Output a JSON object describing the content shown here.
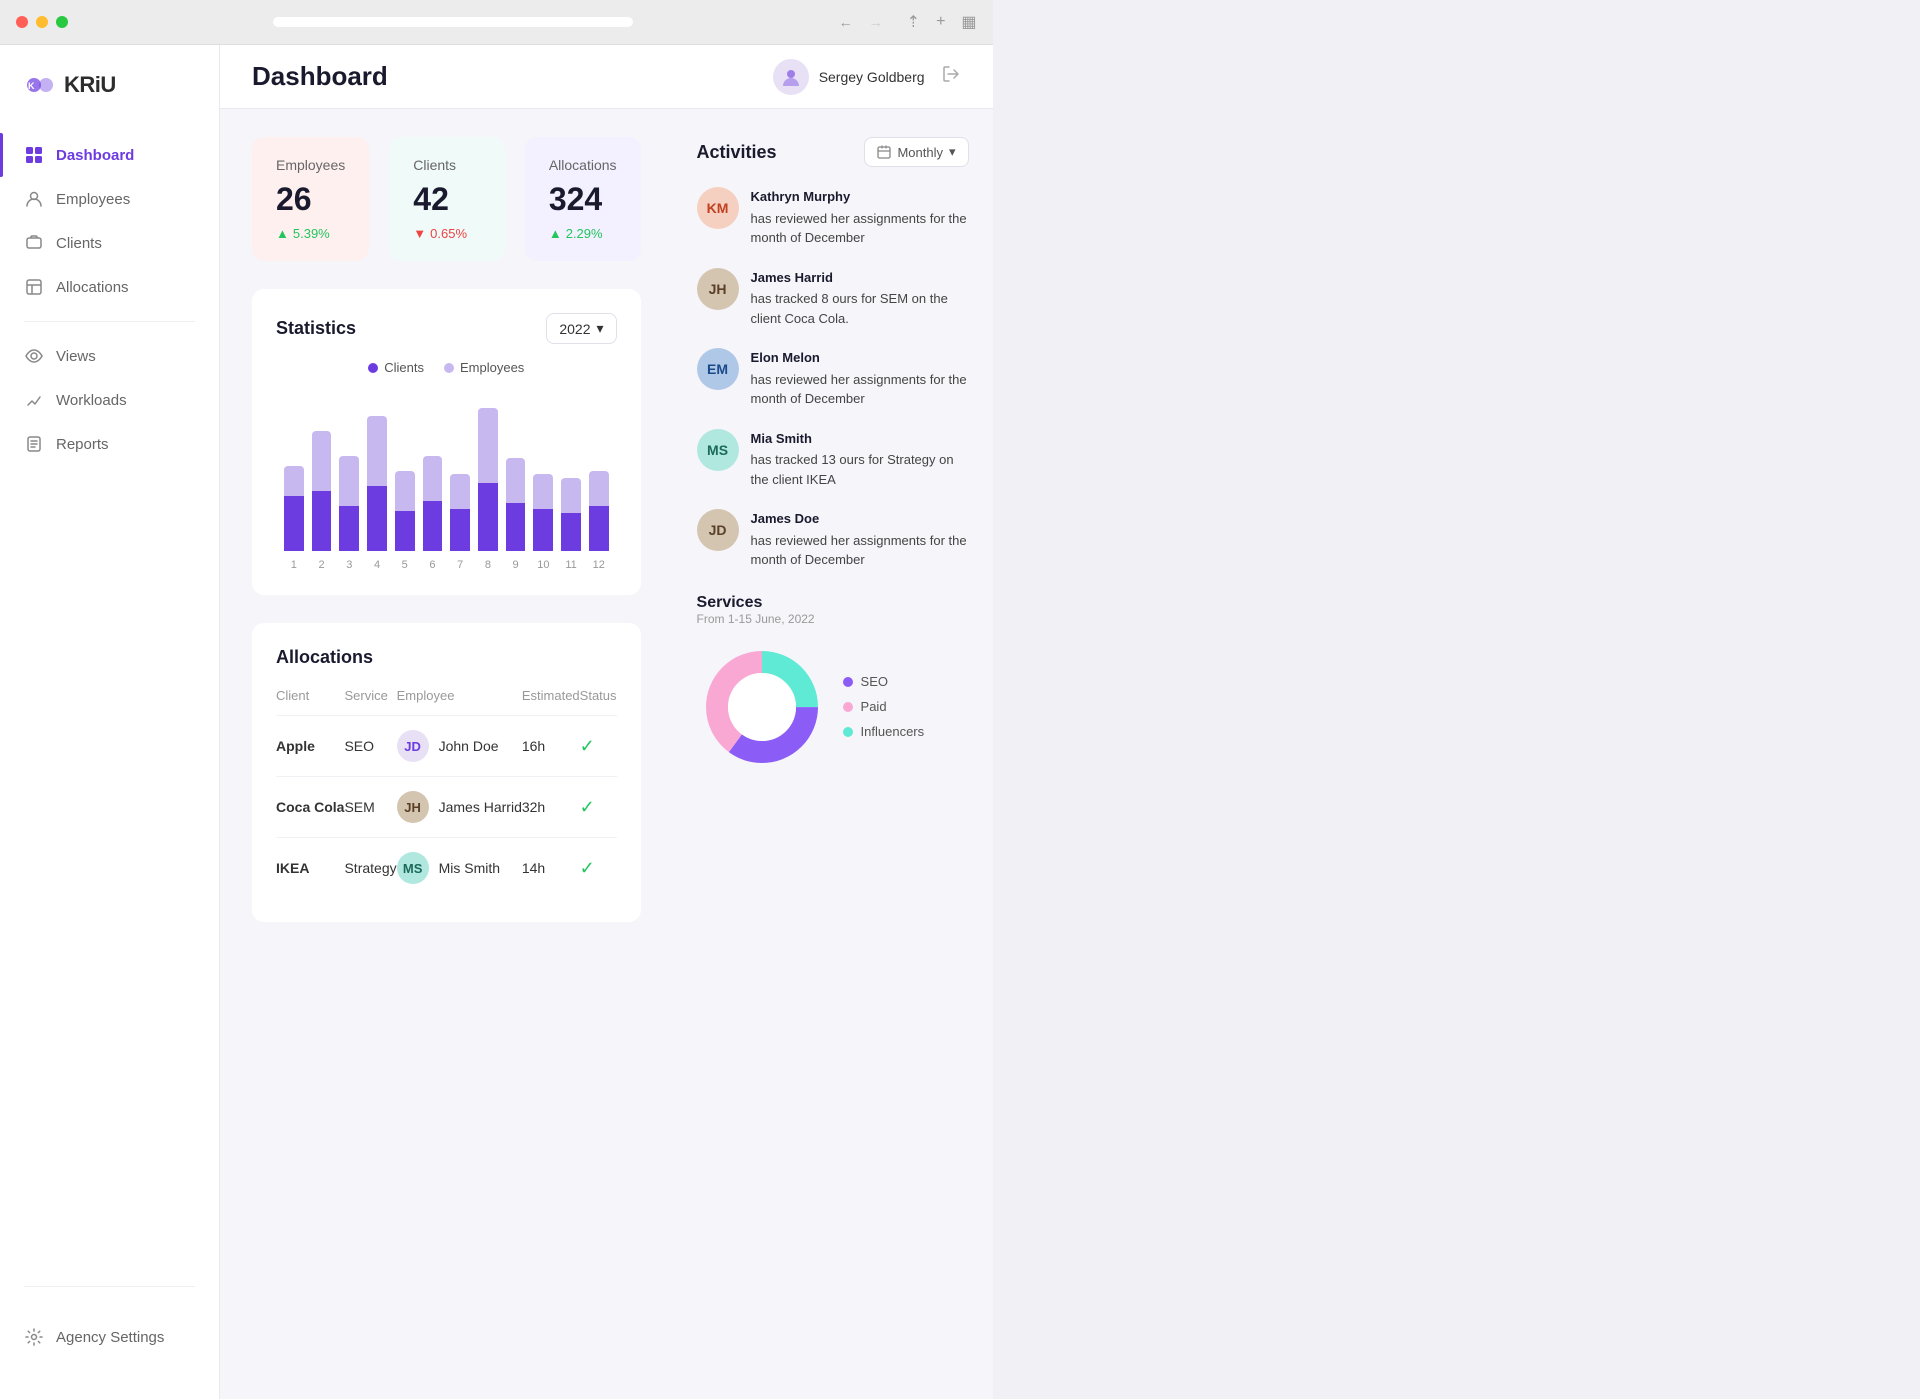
{
  "chrome": {
    "url": ""
  },
  "sidebar": {
    "logo_text": "KRiU",
    "items": [
      {
        "id": "dashboard",
        "label": "Dashboard",
        "active": true
      },
      {
        "id": "employees",
        "label": "Employees",
        "active": false
      },
      {
        "id": "clients",
        "label": "Clients",
        "active": false
      },
      {
        "id": "allocations",
        "label": "Allocations",
        "active": false
      },
      {
        "id": "views",
        "label": "Views",
        "active": false
      },
      {
        "id": "workloads",
        "label": "Workloads",
        "active": false
      },
      {
        "id": "reports",
        "label": "Reports",
        "active": false
      }
    ],
    "bottom": {
      "label": "Agency Settings"
    }
  },
  "topbar": {
    "title": "Dashboard",
    "user_name": "Sergey Goldberg"
  },
  "stats": [
    {
      "id": "employees",
      "label": "Employees",
      "value": "26",
      "change": "5.39%",
      "direction": "up",
      "color": "pink"
    },
    {
      "id": "clients",
      "label": "Clients",
      "value": "42",
      "change": "0.65%",
      "direction": "down",
      "color": "teal"
    },
    {
      "id": "allocations",
      "label": "Allocations",
      "value": "324",
      "change": "2.29%",
      "direction": "up",
      "color": "purple"
    }
  ],
  "statistics": {
    "title": "Statistics",
    "year": "2022",
    "legend": [
      {
        "label": "Clients",
        "color": "#6c3ce1"
      },
      {
        "label": "Employees",
        "color": "#c8b8f0"
      }
    ],
    "bars": [
      {
        "month": "1",
        "clients": 55,
        "employees": 30
      },
      {
        "month": "2",
        "clients": 60,
        "employees": 60
      },
      {
        "month": "3",
        "clients": 45,
        "employees": 50
      },
      {
        "month": "4",
        "clients": 65,
        "employees": 70
      },
      {
        "month": "5",
        "clients": 40,
        "employees": 40
      },
      {
        "month": "6",
        "clients": 50,
        "employees": 45
      },
      {
        "month": "7",
        "clients": 42,
        "employees": 35
      },
      {
        "month": "8",
        "clients": 68,
        "employees": 75
      },
      {
        "month": "9",
        "clients": 48,
        "employees": 45
      },
      {
        "month": "10",
        "clients": 42,
        "employees": 35
      },
      {
        "month": "11",
        "clients": 38,
        "employees": 35
      },
      {
        "month": "12",
        "clients": 45,
        "employees": 35
      }
    ]
  },
  "allocations": {
    "title": "Allocations",
    "columns": [
      "Client",
      "Service",
      "Employee",
      "Estimated",
      "Status"
    ],
    "rows": [
      {
        "client": "Apple",
        "service": "SEO",
        "employee": "John Doe",
        "estimated": "16h",
        "status": "done",
        "av_color": "purple"
      },
      {
        "client": "Coca Cola",
        "service": "SEM",
        "employee": "James Harrid",
        "estimated": "32h",
        "status": "done",
        "av_color": "brown"
      },
      {
        "client": "IKEA",
        "service": "Strategy",
        "employee": "Mis Smith",
        "estimated": "14h",
        "status": "done",
        "av_color": "teal"
      }
    ]
  },
  "activities": {
    "title": "Activities",
    "filter_label": "Monthly",
    "items": [
      {
        "name": "Kathryn Murphy",
        "text": "has reviewed her assignments for the month of December",
        "av_color": "pink"
      },
      {
        "name": "James Harrid",
        "text": "has tracked 8 ours for SEM on the  client Coca Cola.",
        "av_color": "brown"
      },
      {
        "name": "Elon Melon",
        "text": "has reviewed her assignments for the month of December",
        "av_color": "blue"
      },
      {
        "name": "Mia Smith",
        "text": "has tracked 13 ours for Strategy on the  client IKEA",
        "av_color": "teal"
      },
      {
        "name": "James Doe",
        "text": "has reviewed her assignments for the month of December",
        "av_color": "brown"
      }
    ]
  },
  "services": {
    "title": "Services",
    "subtitle": "From 1-15 June, 2022",
    "legend": [
      {
        "label": "SEO",
        "color": "#8b5cf6"
      },
      {
        "label": "Paid",
        "color": "#f9a8d4"
      },
      {
        "label": "Influencers",
        "color": "#5eead4"
      }
    ],
    "donut": {
      "seo_pct": 35,
      "paid_pct": 40,
      "influencers_pct": 25
    }
  }
}
